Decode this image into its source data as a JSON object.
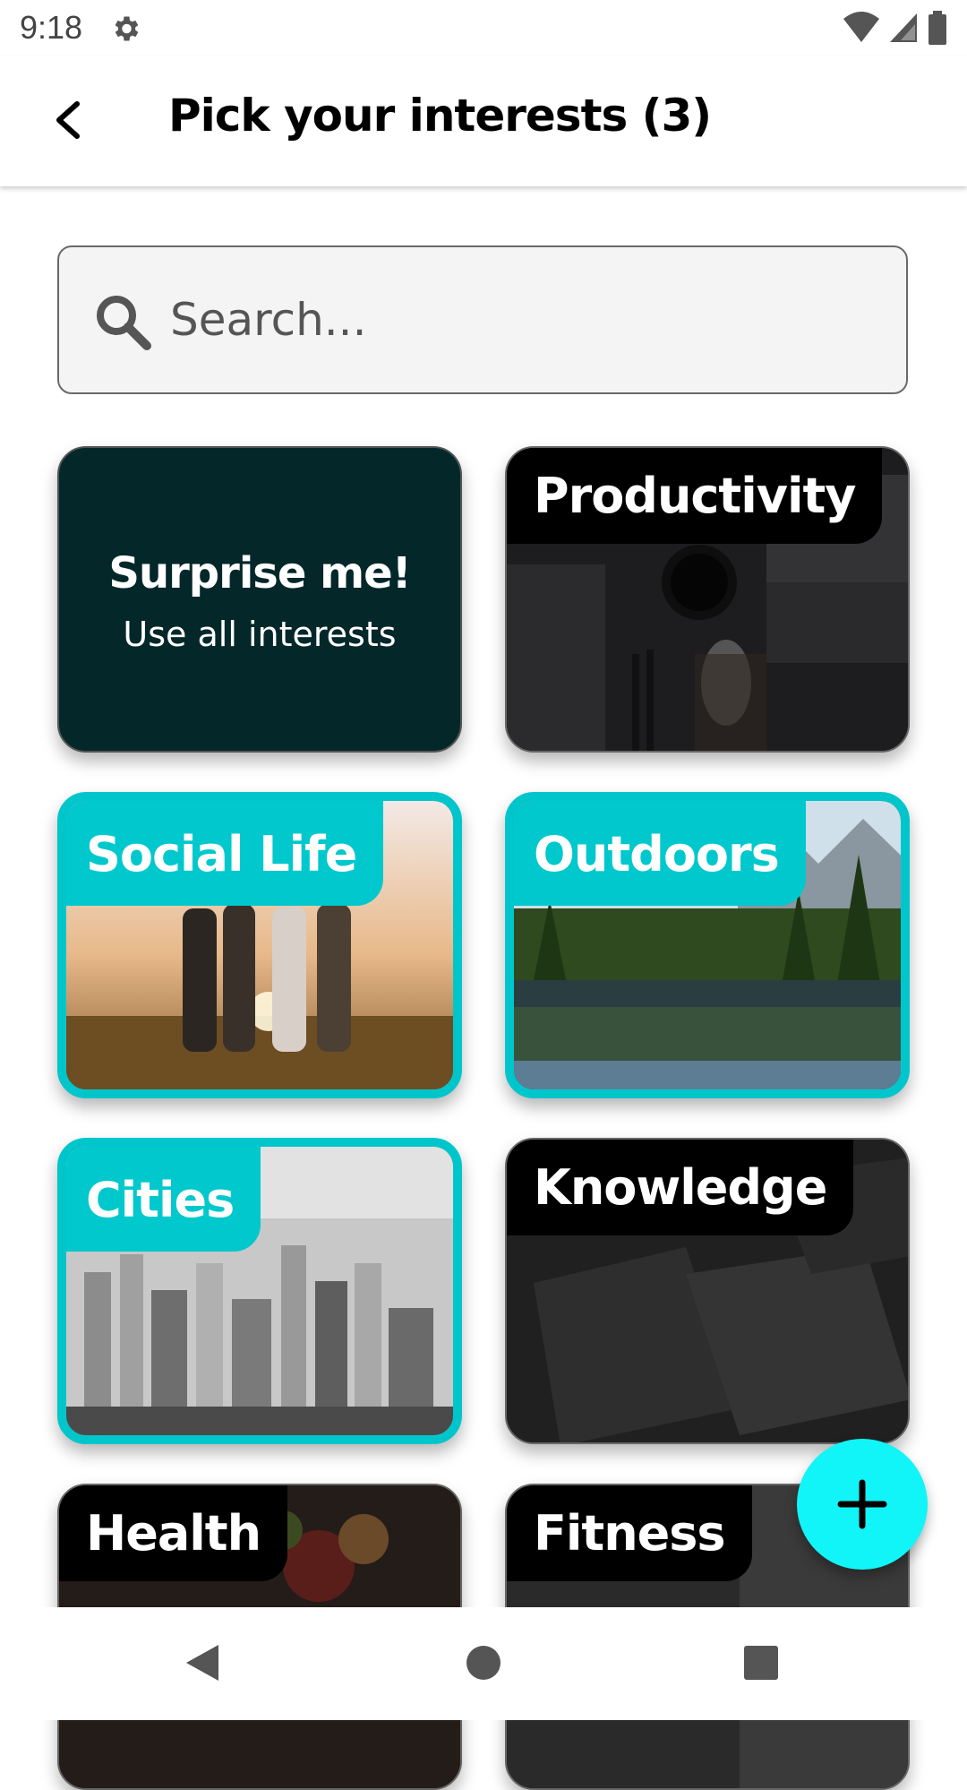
{
  "status": {
    "time": "9:18"
  },
  "header": {
    "title": "Pick your interests (3)"
  },
  "search": {
    "placeholder": "Search..."
  },
  "cards": [
    {
      "title": "Surprise me!",
      "subtitle": "Use all interests",
      "selected": false
    },
    {
      "title": "Productivity",
      "selected": false
    },
    {
      "title": "Social Life",
      "selected": true
    },
    {
      "title": "Outdoors",
      "selected": true
    },
    {
      "title": "Cities",
      "selected": true
    },
    {
      "title": "Knowledge",
      "selected": false
    },
    {
      "title": "Health",
      "selected": false
    },
    {
      "title": "Fitness",
      "selected": false
    }
  ],
  "colors": {
    "accent": "#00c8cc",
    "fab": "#11f5f8",
    "surprise_bg": "#04282a"
  },
  "icons": [
    "gear-icon",
    "wifi-icon",
    "cell-signal-icon",
    "battery-icon",
    "back-arrow-icon",
    "search-icon",
    "plus-icon",
    "nav-back-icon",
    "nav-home-icon",
    "nav-recents-icon"
  ]
}
